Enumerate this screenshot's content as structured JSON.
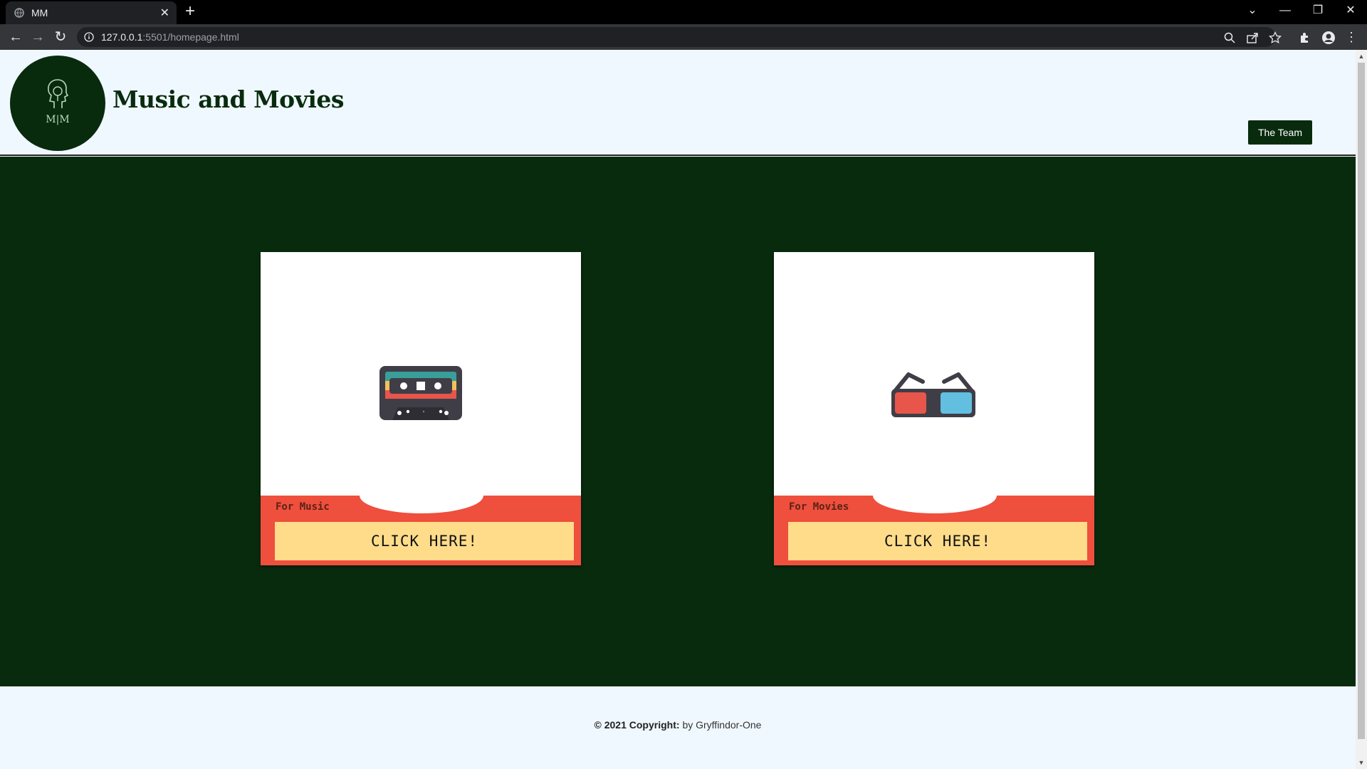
{
  "browser": {
    "tab_title": "MM",
    "url_host": "127.0.0.1",
    "url_rest": ":5501/homepage.html"
  },
  "header": {
    "logo_text": "M|M",
    "brand": "Music and Movies",
    "team_button": "The Team"
  },
  "cards": [
    {
      "caption": "For Music",
      "button": "CLICK HERE!",
      "icon": "cassette-tape-icon"
    },
    {
      "caption": "For Movies",
      "button": "CLICK HERE!",
      "icon": "3d-glasses-icon"
    }
  ],
  "footer": {
    "copyright_bold": "© 2021 Copyright:",
    "by": "by Gryffindor-One"
  },
  "colors": {
    "green": "#082b0e",
    "band": "#ef4f3d",
    "button": "#ffdc8a",
    "page_bg": "#f0f8ff"
  }
}
